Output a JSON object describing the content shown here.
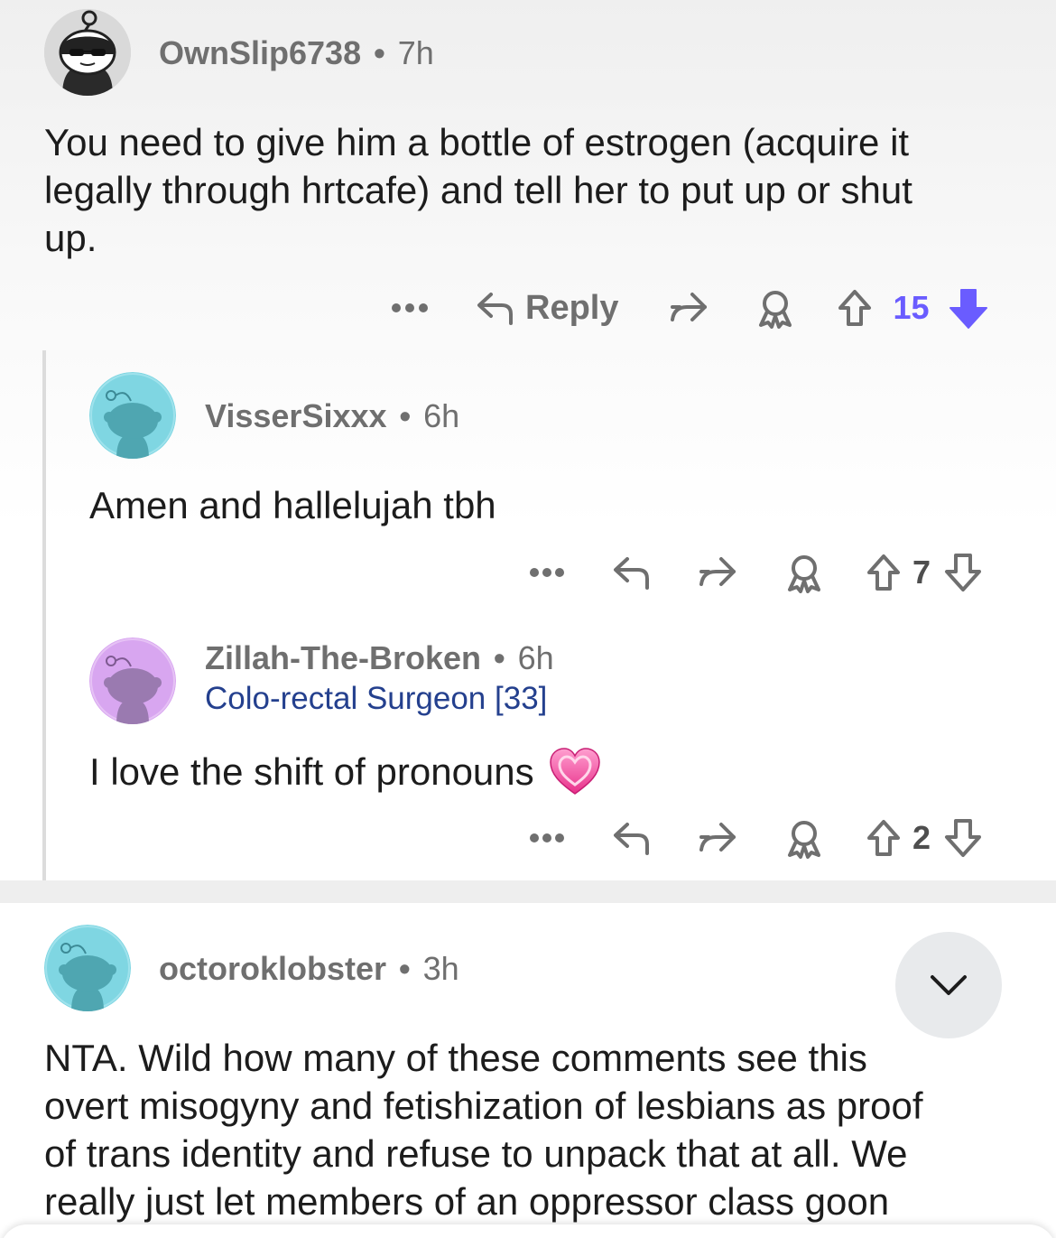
{
  "comments": [
    {
      "username": "OwnSlip6738",
      "separator": "•",
      "time": "7h",
      "body_lines": [
        "You need to give him a bottle of estrogen (acquire it",
        "legally through hrtcafe) and tell her to put up or shut",
        "up."
      ],
      "reply_label": "Reply",
      "votes": "15",
      "vote_state": "downvoted"
    },
    {
      "username": "VisserSixxx",
      "separator": "•",
      "time": "6h",
      "body_lines": [
        "Amen and hallelujah tbh"
      ],
      "votes": "7"
    },
    {
      "username": "Zillah-The-Broken",
      "separator": "•",
      "time": "6h",
      "flair": "Colo-rectal Surgeon [33]",
      "body_lines": [
        "I love the shift of pronouns"
      ],
      "emoji": "💗",
      "votes": "2"
    },
    {
      "username": "octoroklobster",
      "separator": "•",
      "time": "3h",
      "body_lines": [
        "NTA. Wild how many of these comments see this",
        "overt misogyny and fetishization of lesbians as proof",
        "of trans identity and refuse to unpack that at all. We",
        "really just let members of an oppressor class goon"
      ]
    }
  ],
  "icons": {
    "more": "more-options-icon",
    "reply": "reply-arrow-icon",
    "share": "share-icon",
    "award": "award-icon",
    "upvote": "upvote-arrow-icon",
    "downvote": "downvote-arrow-icon",
    "collapse": "chevron-down-icon"
  },
  "colors": {
    "downvote_active": "#6a5cff",
    "flair": "#24408e",
    "avatar_teal": "#7fd6e2",
    "avatar_purple": "#d8a6f0"
  }
}
